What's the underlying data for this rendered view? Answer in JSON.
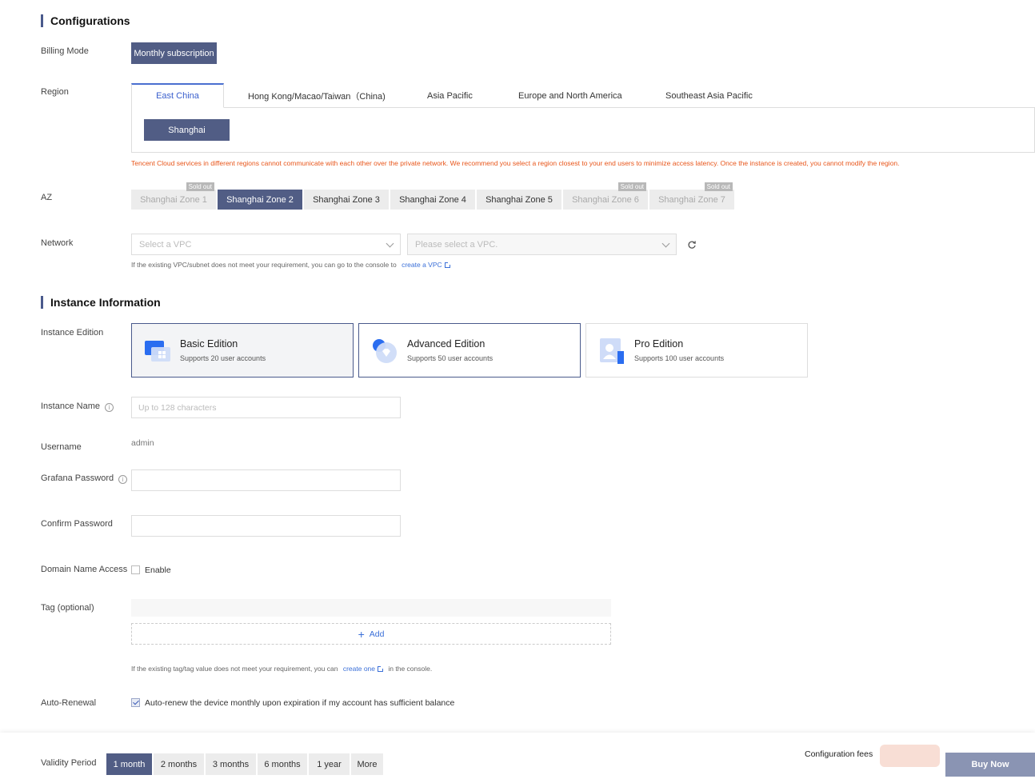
{
  "configurations": {
    "title": "Configurations",
    "billing_mode": {
      "label": "Billing Mode",
      "value": "Monthly subscription"
    },
    "region": {
      "label": "Region",
      "tabs": [
        "East China",
        "Hong Kong/Macao/Taiwan（China)",
        "Asia Pacific",
        "Europe and North America",
        "Southeast Asia Pacific"
      ],
      "selected_city": "Shanghai",
      "warning": "Tencent Cloud services in different regions cannot communicate with each other over the private network. We recommend you select a region closest to your end users to minimize access latency. Once the instance is created, you cannot modify the region."
    },
    "az": {
      "label": "AZ",
      "sold_out_label": "Sold out",
      "zones": [
        "Shanghai Zone 1",
        "Shanghai Zone 2",
        "Shanghai Zone 3",
        "Shanghai Zone 4",
        "Shanghai Zone 5",
        "Shanghai Zone 6",
        "Shanghai Zone 7"
      ]
    },
    "network": {
      "label": "Network",
      "vpc_placeholder": "Select a VPC",
      "subnet_placeholder": "Please select a VPC.",
      "hint": "If the existing VPC/subnet does not meet your requirement, you can go to the console to",
      "hint_link": "create a VPC"
    }
  },
  "instance_info": {
    "title": "Instance Information",
    "edition": {
      "label": "Instance Edition",
      "options": [
        {
          "title": "Basic Edition",
          "sub": "Supports 20 user accounts"
        },
        {
          "title": "Advanced Edition",
          "sub": "Supports 50 user accounts"
        },
        {
          "title": "Pro Edition",
          "sub": "Supports 100 user accounts"
        }
      ]
    },
    "instance_name": {
      "label": "Instance Name",
      "placeholder": "Up to 128 characters"
    },
    "username": {
      "label": "Username",
      "value": "admin"
    },
    "grafana_password": {
      "label": "Grafana Password"
    },
    "confirm_password": {
      "label": "Confirm Password"
    },
    "domain_access": {
      "label": "Domain Name Access",
      "option": "Enable"
    },
    "tag": {
      "label": "Tag (optional)",
      "add_label": "Add",
      "hint_pre": "If the existing tag/tag value does not meet your requirement, you can",
      "hint_link": "create one",
      "hint_post": "in the console."
    },
    "auto_renewal": {
      "label": "Auto-Renewal",
      "text": "Auto-renew the device monthly upon expiration if my account has sufficient balance"
    }
  },
  "footer": {
    "validity_label": "Validity Period",
    "periods": [
      "1 month",
      "2 months",
      "3 months",
      "6 months",
      "1 year",
      "More"
    ],
    "fees_label": "Configuration fees",
    "buy_label": "Buy Now"
  },
  "colors": {
    "primary": "#515d85",
    "link": "#3a6fd8",
    "warning": "#e8561b",
    "buy": "#8a94b3"
  },
  "icons": {
    "refresh": "refresh-icon",
    "info": "info-icon",
    "plus": "plus-icon",
    "external": "external-link-icon"
  }
}
